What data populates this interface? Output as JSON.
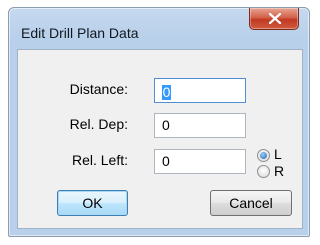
{
  "window": {
    "title": "Edit Drill Plan Data"
  },
  "title_bar": {
    "close_icon": "close-x-icon"
  },
  "form": {
    "distance": {
      "label": "Distance:",
      "value": "0"
    },
    "rel_dep": {
      "label": "Rel. Dep:",
      "value": "0"
    },
    "rel_left": {
      "label": "Rel. Left:",
      "value": "0"
    }
  },
  "side": {
    "left_label": "L",
    "right_label": "R",
    "selected": "L"
  },
  "buttons": {
    "ok": "OK",
    "cancel": "Cancel"
  }
}
